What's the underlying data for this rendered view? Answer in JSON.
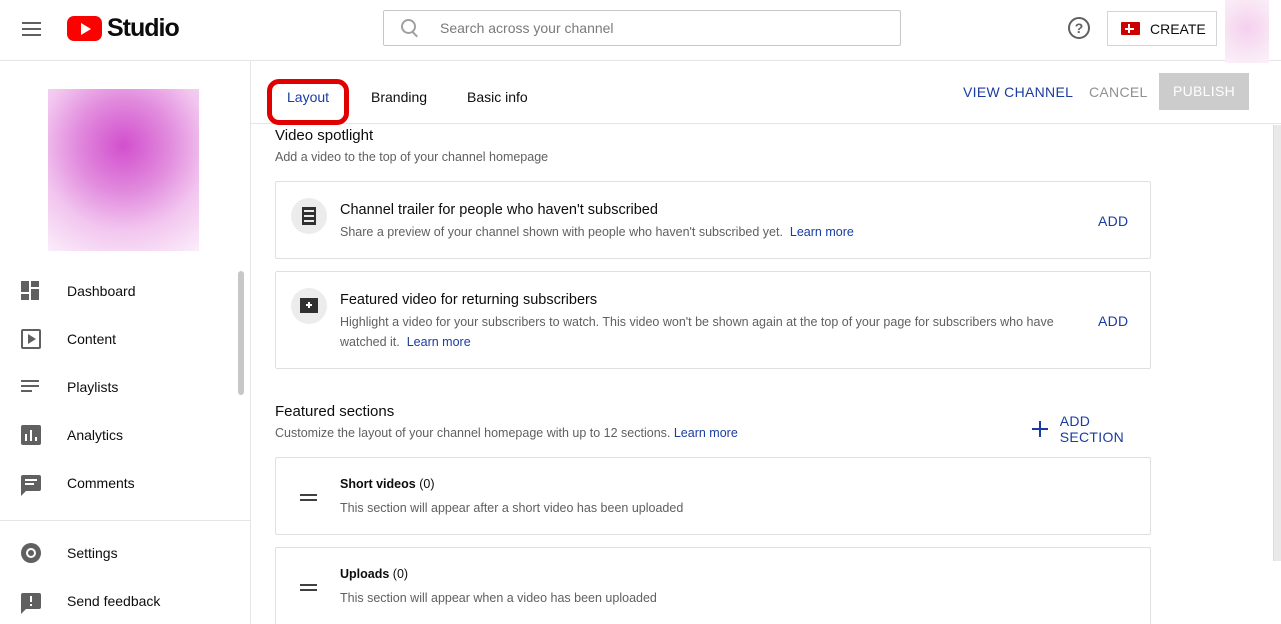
{
  "app": {
    "logo_text": "Studio"
  },
  "header": {
    "search_placeholder": "Search across your channel",
    "help_glyph": "?",
    "create_label": "CREATE"
  },
  "sidebar": {
    "items": [
      {
        "label": "Dashboard",
        "icon": "dashboard-icon"
      },
      {
        "label": "Content",
        "icon": "content-icon"
      },
      {
        "label": "Playlists",
        "icon": "playlists-icon"
      },
      {
        "label": "Analytics",
        "icon": "analytics-icon"
      },
      {
        "label": "Comments",
        "icon": "comments-icon"
      }
    ],
    "bottom_items": [
      {
        "label": "Settings",
        "icon": "gear-icon"
      },
      {
        "label": "Send feedback",
        "icon": "feedback-icon"
      }
    ]
  },
  "tabs": [
    {
      "label": "Layout",
      "active": true
    },
    {
      "label": "Branding",
      "active": false
    },
    {
      "label": "Basic info",
      "active": false
    }
  ],
  "actions": {
    "view_channel": "VIEW CHANNEL",
    "cancel": "CANCEL",
    "publish": "PUBLISH"
  },
  "spotlight": {
    "title": "Video spotlight",
    "subtitle": "Add a video to the top of your channel homepage",
    "cards": [
      {
        "title": "Channel trailer for people who haven't subscribed",
        "description": "Share a preview of your channel shown with people who haven't subscribed yet.",
        "link": "Learn more",
        "action": "ADD"
      },
      {
        "title": "Featured video for returning subscribers",
        "description": "Highlight a video for your subscribers to watch. This video won't be shown again at the top of your page for subscribers who have watched it.",
        "link": "Learn more",
        "action": "ADD"
      }
    ]
  },
  "featured": {
    "title": "Featured sections",
    "subtitle": "Customize the layout of your channel homepage with up to 12 sections.",
    "link": "Learn more",
    "add_section": "ADD SECTION",
    "sections": [
      {
        "title": "Short videos",
        "count": "(0)",
        "description": "This section will appear after a short video has been uploaded"
      },
      {
        "title": "Uploads",
        "count": "(0)",
        "description": "This section will appear when a video has been uploaded"
      }
    ]
  },
  "colors": {
    "accent": "#1a3ca0",
    "brand_red": "#ff0000",
    "highlight": "#e00000",
    "disabled": "#cccccc"
  }
}
